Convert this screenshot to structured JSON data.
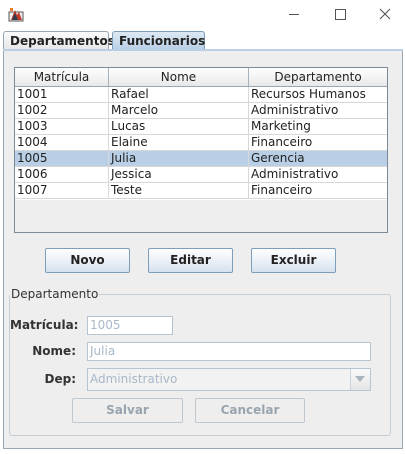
{
  "window": {
    "minimize_glyph": "",
    "maximize_glyph": "",
    "close_glyph": ""
  },
  "tabs": [
    {
      "label": "Departamentos"
    },
    {
      "label": "Funcionarios"
    }
  ],
  "table": {
    "columns": [
      "Matrícula",
      "Nome",
      "Departamento"
    ],
    "rows": [
      [
        "1001",
        "Rafael",
        "Recursos Humanos"
      ],
      [
        "1002",
        "Marcelo",
        "Administrativo"
      ],
      [
        "1003",
        "Lucas",
        "Marketing"
      ],
      [
        "1004",
        "Elaine",
        "Financeiro"
      ],
      [
        "1005",
        "Julia",
        "Gerencia"
      ],
      [
        "1006",
        "Jessica",
        "Administrativo"
      ],
      [
        "1007",
        "Teste",
        "Financeiro"
      ]
    ],
    "selected_row_index": 4,
    "selection_color": "#b8cfe5"
  },
  "actions": {
    "novo": "Novo",
    "editar": "Editar",
    "excluir": "Excluir"
  },
  "form": {
    "group_title": "Departamento",
    "matricula_label": "Matrícula:",
    "matricula_value": "1005",
    "nome_label": "Nome:",
    "nome_value": "Julia",
    "dep_label": "Dep:",
    "dep_value": "Administrativo",
    "salvar": "Salvar",
    "cancelar": "Cancelar"
  }
}
